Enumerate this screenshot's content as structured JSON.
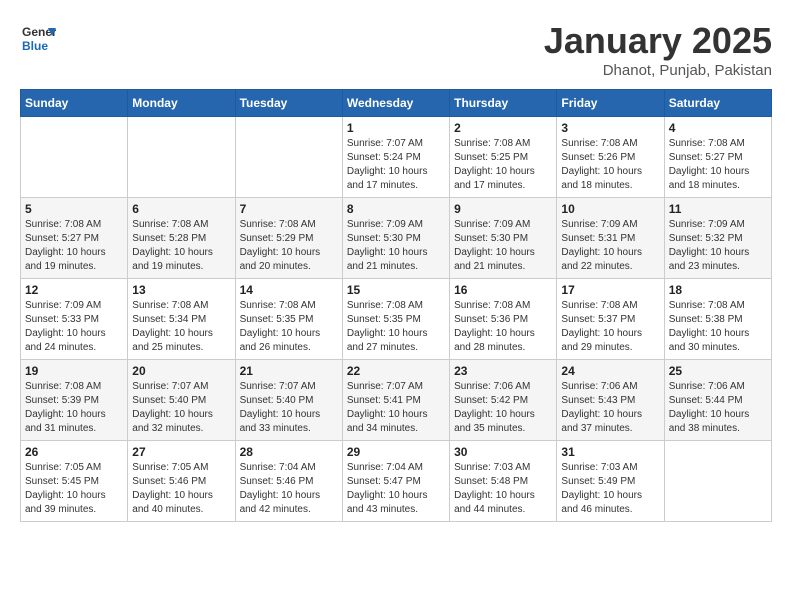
{
  "header": {
    "logo_line1": "General",
    "logo_line2": "Blue",
    "title": "January 2025",
    "subtitle": "Dhanot, Punjab, Pakistan"
  },
  "weekdays": [
    "Sunday",
    "Monday",
    "Tuesday",
    "Wednesday",
    "Thursday",
    "Friday",
    "Saturday"
  ],
  "weeks": [
    [
      {
        "day": "",
        "info": ""
      },
      {
        "day": "",
        "info": ""
      },
      {
        "day": "",
        "info": ""
      },
      {
        "day": "1",
        "info": "Sunrise: 7:07 AM\nSunset: 5:24 PM\nDaylight: 10 hours\nand 17 minutes."
      },
      {
        "day": "2",
        "info": "Sunrise: 7:08 AM\nSunset: 5:25 PM\nDaylight: 10 hours\nand 17 minutes."
      },
      {
        "day": "3",
        "info": "Sunrise: 7:08 AM\nSunset: 5:26 PM\nDaylight: 10 hours\nand 18 minutes."
      },
      {
        "day": "4",
        "info": "Sunrise: 7:08 AM\nSunset: 5:27 PM\nDaylight: 10 hours\nand 18 minutes."
      }
    ],
    [
      {
        "day": "5",
        "info": "Sunrise: 7:08 AM\nSunset: 5:27 PM\nDaylight: 10 hours\nand 19 minutes."
      },
      {
        "day": "6",
        "info": "Sunrise: 7:08 AM\nSunset: 5:28 PM\nDaylight: 10 hours\nand 19 minutes."
      },
      {
        "day": "7",
        "info": "Sunrise: 7:08 AM\nSunset: 5:29 PM\nDaylight: 10 hours\nand 20 minutes."
      },
      {
        "day": "8",
        "info": "Sunrise: 7:09 AM\nSunset: 5:30 PM\nDaylight: 10 hours\nand 21 minutes."
      },
      {
        "day": "9",
        "info": "Sunrise: 7:09 AM\nSunset: 5:30 PM\nDaylight: 10 hours\nand 21 minutes."
      },
      {
        "day": "10",
        "info": "Sunrise: 7:09 AM\nSunset: 5:31 PM\nDaylight: 10 hours\nand 22 minutes."
      },
      {
        "day": "11",
        "info": "Sunrise: 7:09 AM\nSunset: 5:32 PM\nDaylight: 10 hours\nand 23 minutes."
      }
    ],
    [
      {
        "day": "12",
        "info": "Sunrise: 7:09 AM\nSunset: 5:33 PM\nDaylight: 10 hours\nand 24 minutes."
      },
      {
        "day": "13",
        "info": "Sunrise: 7:08 AM\nSunset: 5:34 PM\nDaylight: 10 hours\nand 25 minutes."
      },
      {
        "day": "14",
        "info": "Sunrise: 7:08 AM\nSunset: 5:35 PM\nDaylight: 10 hours\nand 26 minutes."
      },
      {
        "day": "15",
        "info": "Sunrise: 7:08 AM\nSunset: 5:35 PM\nDaylight: 10 hours\nand 27 minutes."
      },
      {
        "day": "16",
        "info": "Sunrise: 7:08 AM\nSunset: 5:36 PM\nDaylight: 10 hours\nand 28 minutes."
      },
      {
        "day": "17",
        "info": "Sunrise: 7:08 AM\nSunset: 5:37 PM\nDaylight: 10 hours\nand 29 minutes."
      },
      {
        "day": "18",
        "info": "Sunrise: 7:08 AM\nSunset: 5:38 PM\nDaylight: 10 hours\nand 30 minutes."
      }
    ],
    [
      {
        "day": "19",
        "info": "Sunrise: 7:08 AM\nSunset: 5:39 PM\nDaylight: 10 hours\nand 31 minutes."
      },
      {
        "day": "20",
        "info": "Sunrise: 7:07 AM\nSunset: 5:40 PM\nDaylight: 10 hours\nand 32 minutes."
      },
      {
        "day": "21",
        "info": "Sunrise: 7:07 AM\nSunset: 5:40 PM\nDaylight: 10 hours\nand 33 minutes."
      },
      {
        "day": "22",
        "info": "Sunrise: 7:07 AM\nSunset: 5:41 PM\nDaylight: 10 hours\nand 34 minutes."
      },
      {
        "day": "23",
        "info": "Sunrise: 7:06 AM\nSunset: 5:42 PM\nDaylight: 10 hours\nand 35 minutes."
      },
      {
        "day": "24",
        "info": "Sunrise: 7:06 AM\nSunset: 5:43 PM\nDaylight: 10 hours\nand 37 minutes."
      },
      {
        "day": "25",
        "info": "Sunrise: 7:06 AM\nSunset: 5:44 PM\nDaylight: 10 hours\nand 38 minutes."
      }
    ],
    [
      {
        "day": "26",
        "info": "Sunrise: 7:05 AM\nSunset: 5:45 PM\nDaylight: 10 hours\nand 39 minutes."
      },
      {
        "day": "27",
        "info": "Sunrise: 7:05 AM\nSunset: 5:46 PM\nDaylight: 10 hours\nand 40 minutes."
      },
      {
        "day": "28",
        "info": "Sunrise: 7:04 AM\nSunset: 5:46 PM\nDaylight: 10 hours\nand 42 minutes."
      },
      {
        "day": "29",
        "info": "Sunrise: 7:04 AM\nSunset: 5:47 PM\nDaylight: 10 hours\nand 43 minutes."
      },
      {
        "day": "30",
        "info": "Sunrise: 7:03 AM\nSunset: 5:48 PM\nDaylight: 10 hours\nand 44 minutes."
      },
      {
        "day": "31",
        "info": "Sunrise: 7:03 AM\nSunset: 5:49 PM\nDaylight: 10 hours\nand 46 minutes."
      },
      {
        "day": "",
        "info": ""
      }
    ]
  ]
}
